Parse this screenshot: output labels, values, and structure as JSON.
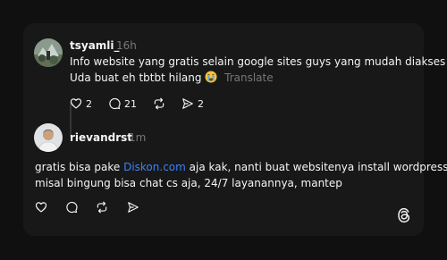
{
  "post": {
    "username": "tsyamli_",
    "time": "16h",
    "line1": "Info website yang gratis selain google sites guys yang mudah diakses",
    "line2": "Uda buat eh tbtbt hilang",
    "translate_label": "Translate",
    "likes": "2",
    "replies": "21",
    "shares": "2"
  },
  "reply": {
    "username": "rievandrst",
    "time": "1m",
    "line1_prefix": "gratis bisa pake ",
    "link_text": "Diskon.com",
    "line1_suffix": " aja kak, nanti buat websitenya install wordpress",
    "line2": "misal bingung bisa chat cs aja, 24/7 layanannya, mantep"
  },
  "icons": {
    "like": "heart-icon",
    "reply": "comment-icon",
    "repost": "repost-icon",
    "share": "send-icon",
    "emoji": "crying-face-emoji",
    "brand": "threads-logo-icon"
  },
  "colors": {
    "background": "#101010",
    "card": "#181818",
    "text": "#f3f5f7",
    "muted": "#777777",
    "link": "#3b82f6"
  }
}
